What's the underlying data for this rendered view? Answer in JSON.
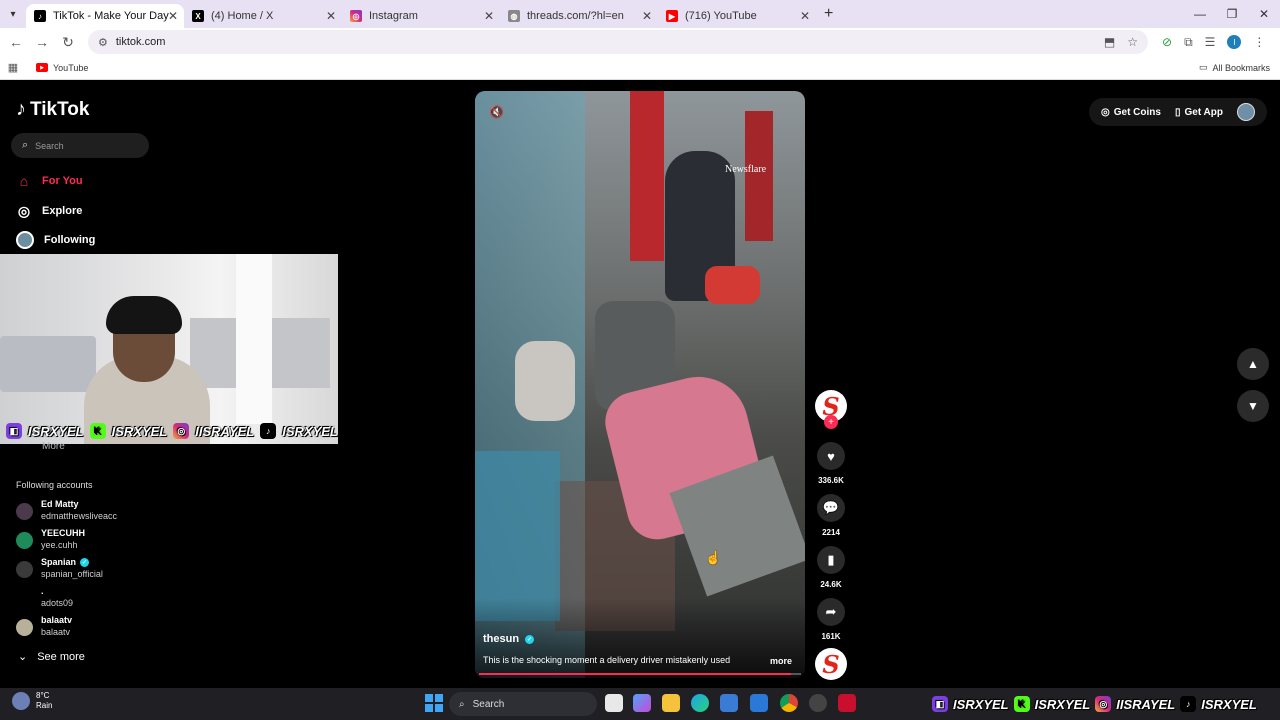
{
  "browser": {
    "tabs": [
      {
        "title": "TikTok - Make Your Day",
        "active": true,
        "icon": "tiktok-icon"
      },
      {
        "title": "(4) Home / X",
        "active": false,
        "icon": "x-icon"
      },
      {
        "title": "Instagram",
        "active": false,
        "icon": "instagram-icon"
      },
      {
        "title": "threads.com/?hl=en",
        "active": false,
        "icon": "globe-icon"
      },
      {
        "title": "(716) YouTube",
        "active": false,
        "icon": "youtube-icon"
      }
    ],
    "url": "tiktok.com",
    "bookmark": "YouTube",
    "all_bookmarks": "All Bookmarks",
    "profile_initial": "I"
  },
  "sidebar": {
    "logo": "TikTok",
    "search_placeholder": "Search",
    "nav": [
      {
        "label": "For You",
        "active": true,
        "icon": "home-icon"
      },
      {
        "label": "Explore",
        "active": false,
        "icon": "compass-icon"
      },
      {
        "label": "Following",
        "active": false,
        "icon": "following-avatar"
      }
    ],
    "more_label": "More",
    "following_title": "Following accounts",
    "accounts": [
      {
        "name": "Ed Matty",
        "handle": "edmatthewsliveacc",
        "verified": false,
        "color": "#4a3a4c"
      },
      {
        "name": "YEECUHH",
        "handle": "yee.cuhh",
        "verified": false,
        "color": "#1f8a5a"
      },
      {
        "name": "Spanian",
        "handle": "spanian_official",
        "verified": true,
        "color": "#3a3a3a"
      },
      {
        "name": ".",
        "handle": "adots09",
        "verified": false,
        "color": "#000000"
      },
      {
        "name": "balaatv",
        "handle": "balaatv",
        "verified": false,
        "color": "#b8b098"
      }
    ],
    "see_more": "See more"
  },
  "stream_overlay": {
    "handles": [
      "ISRXYEL",
      "ISRXYEL",
      "IISRAYEL",
      "ISRXYEL"
    ],
    "taskbar_handles": [
      "ISRXYEL",
      "ISRXYEL",
      "IISRAYEL",
      "ISRXYEL"
    ]
  },
  "video": {
    "watermark": "Newsflare",
    "author": "thesun",
    "verified": true,
    "caption": "This is the shocking moment a delivery driver mistakenly used",
    "more": "more",
    "progress": 0.97
  },
  "actions": {
    "likes": "336.6K",
    "comments": "2214",
    "saves": "24.6K",
    "shares": "161K",
    "creator_logo": "S"
  },
  "topbar": {
    "get_coins": "Get Coins",
    "get_app": "Get App"
  },
  "taskbar": {
    "temp": "8°C",
    "weather": "Rain",
    "search": "Search"
  },
  "colors": {
    "accent": "#fe2c55",
    "verified": "#20d5ec",
    "tab_bar": "#e8e0f3"
  }
}
